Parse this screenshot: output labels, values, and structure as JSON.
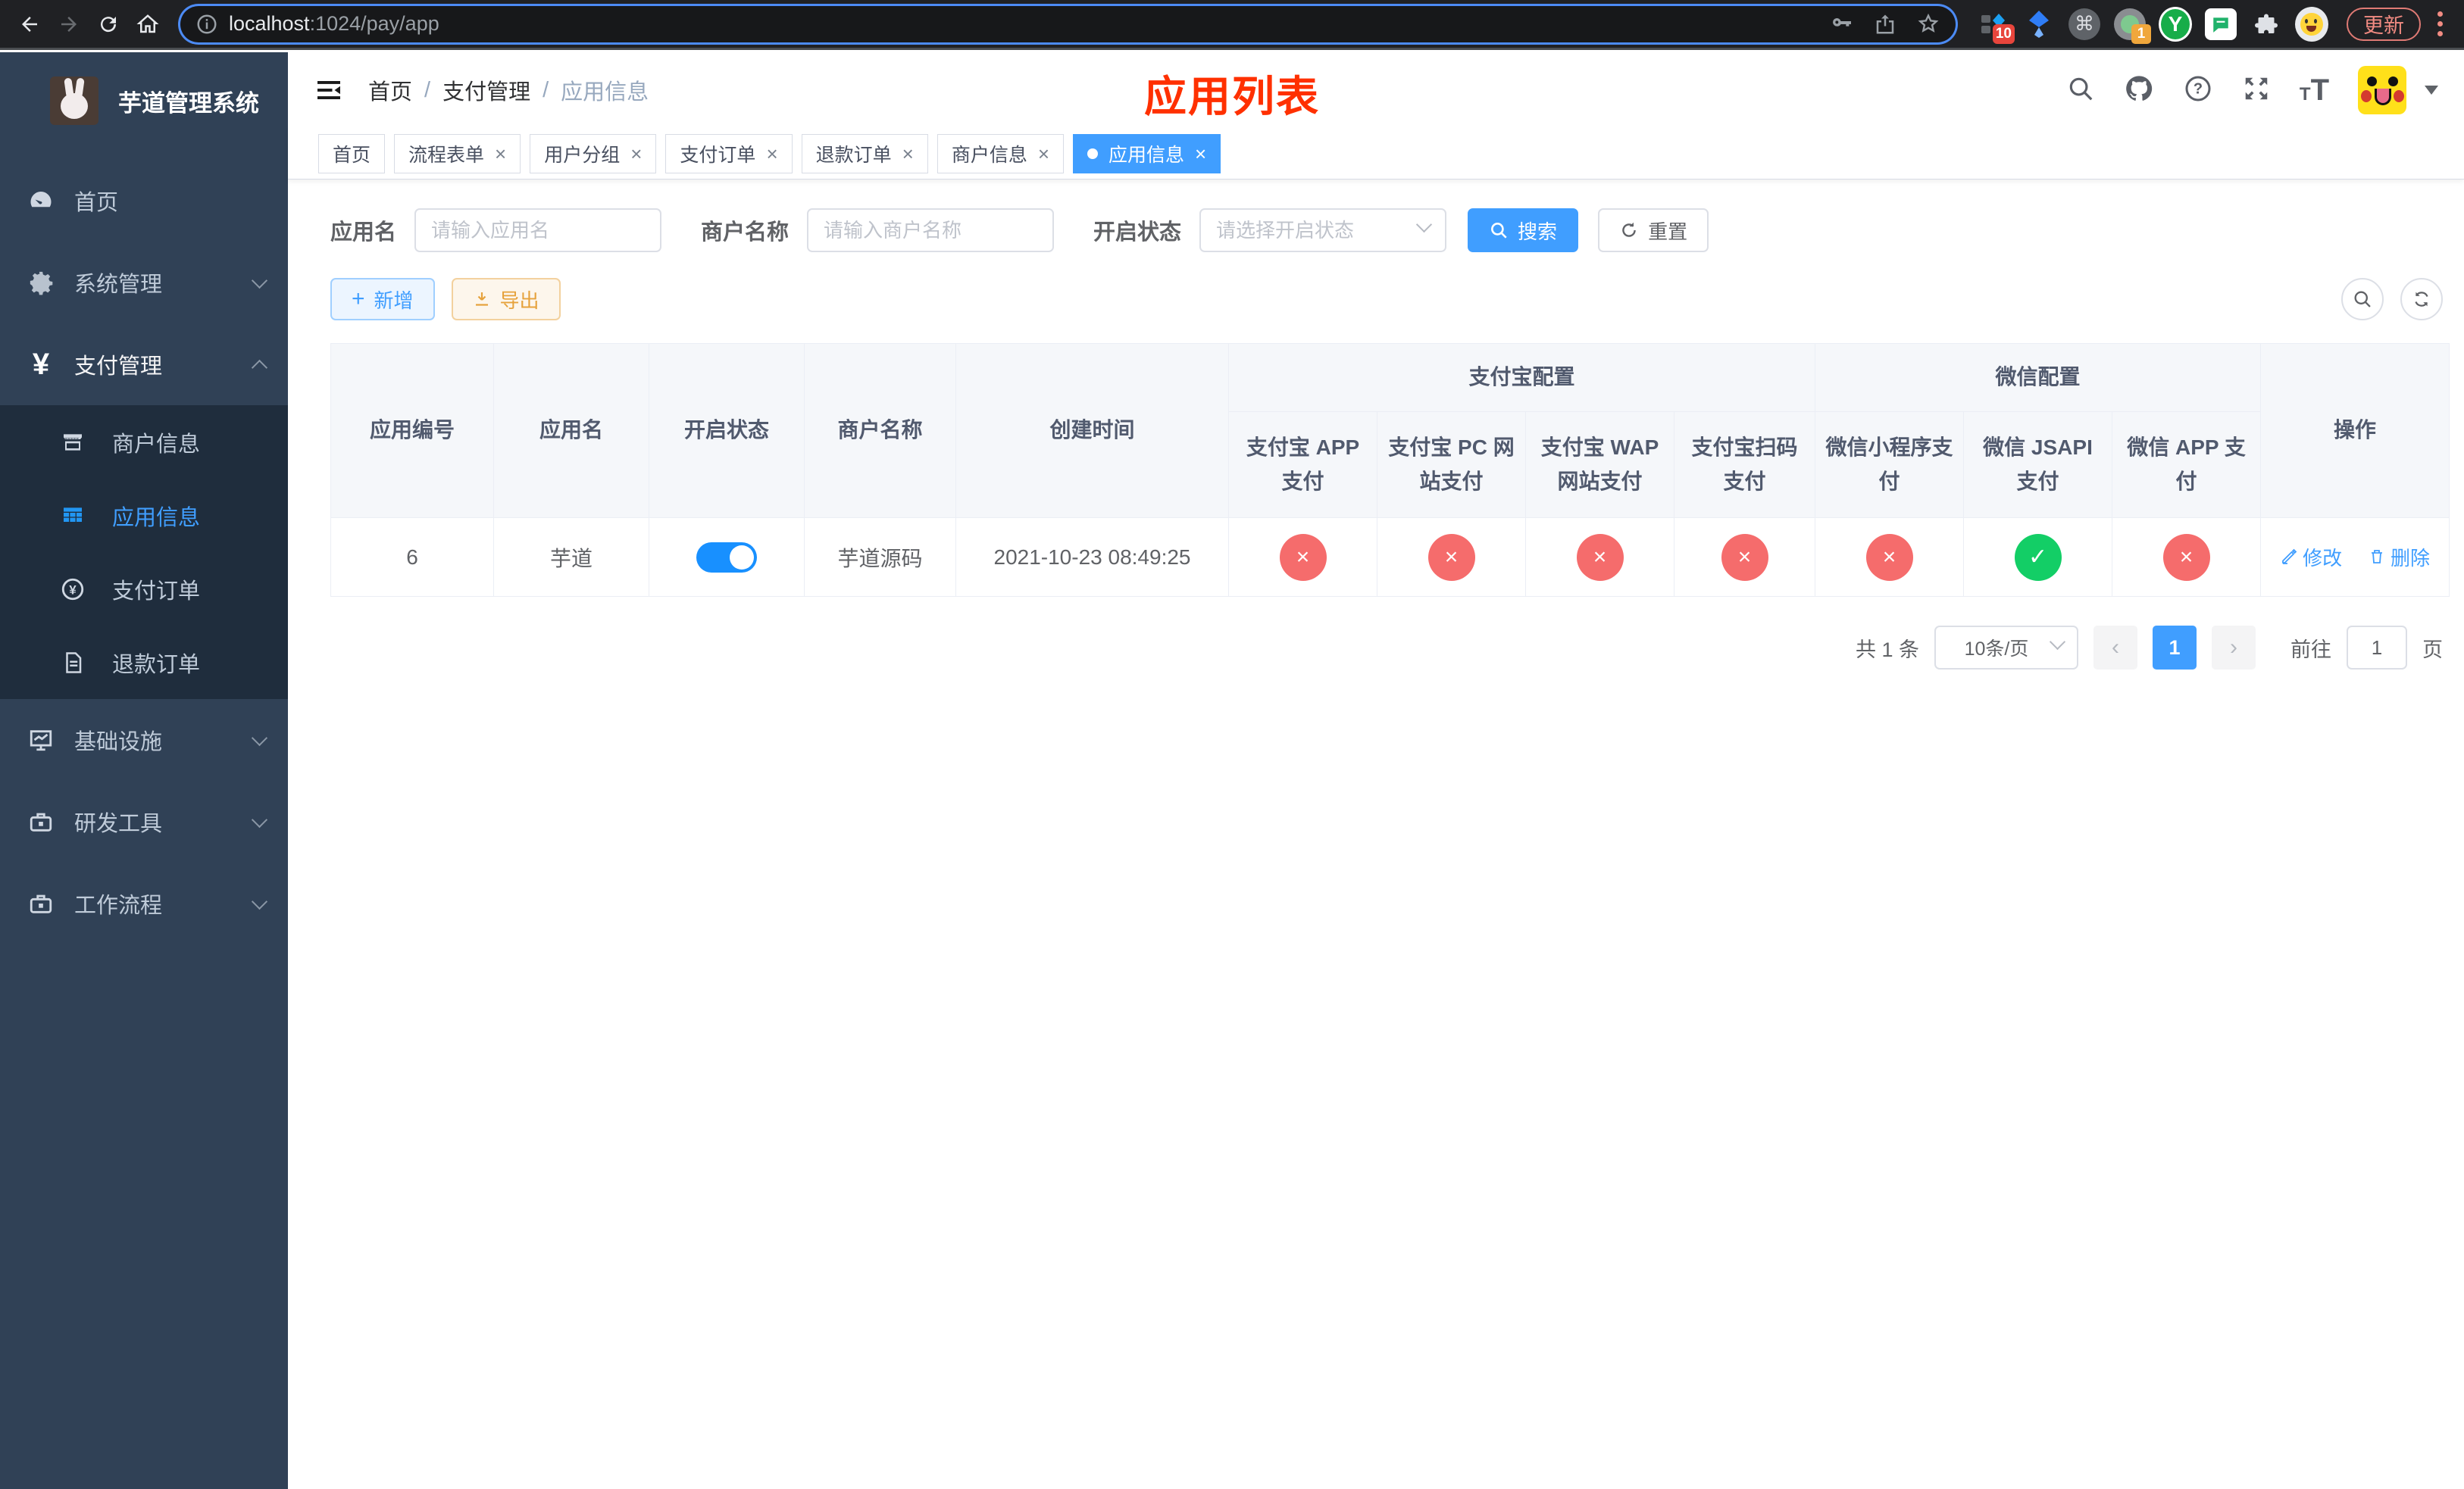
{
  "browser": {
    "url_host": "localhost",
    "url_rest": ":1024/pay/app",
    "update_label": "更新",
    "ext_badge_blocker": "10",
    "ext_badge_proxy": "1"
  },
  "sidebar": {
    "title": "芋道管理系统",
    "items": [
      {
        "label": "首页"
      },
      {
        "label": "系统管理"
      },
      {
        "label": "支付管理"
      },
      {
        "label": "基础设施"
      },
      {
        "label": "研发工具"
      },
      {
        "label": "工作流程"
      }
    ],
    "submenu": [
      {
        "label": "商户信息"
      },
      {
        "label": "应用信息"
      },
      {
        "label": "支付订单"
      },
      {
        "label": "退款订单"
      }
    ]
  },
  "navbar": {
    "breadcrumb": [
      "首页",
      "支付管理",
      "应用信息"
    ],
    "page_title": "应用列表"
  },
  "tabs": [
    {
      "label": "首页"
    },
    {
      "label": "流程表单"
    },
    {
      "label": "用户分组"
    },
    {
      "label": "支付订单"
    },
    {
      "label": "退款订单"
    },
    {
      "label": "商户信息"
    },
    {
      "label": "应用信息"
    }
  ],
  "filters": {
    "app_name_label": "应用名",
    "app_name_placeholder": "请输入应用名",
    "merchant_label": "商户名称",
    "merchant_placeholder": "请输入商户名称",
    "status_label": "开启状态",
    "status_placeholder": "请选择开启状态",
    "search_label": "搜索",
    "reset_label": "重置"
  },
  "toolbar": {
    "add_label": "新增",
    "export_label": "导出"
  },
  "table": {
    "columns": [
      "应用编号",
      "应用名",
      "开启状态",
      "商户名称",
      "创建时间"
    ],
    "groups": [
      {
        "label": "支付宝配置",
        "children": [
          "支付宝 APP 支付",
          "支付宝 PC 网站支付",
          "支付宝 WAP 网站支付",
          "支付宝扫码支付"
        ]
      },
      {
        "label": "微信配置",
        "children": [
          "微信小程序支付",
          "微信 JSAPI 支付",
          "微信 APP 支付"
        ]
      }
    ],
    "actions_column": "操作",
    "row": {
      "id": "6",
      "name": "芋道",
      "enabled": true,
      "merchant": "芋道源码",
      "created_at": "2021-10-23 08:49:25",
      "configs": [
        "disabled",
        "disabled",
        "disabled",
        "disabled",
        "disabled",
        "enabled",
        "disabled"
      ],
      "edit_label": "修改",
      "delete_label": "删除"
    }
  },
  "pagination": {
    "total_label": "共 1 条",
    "page_size": "10条/页",
    "current_page": "1",
    "goto_label": "前往",
    "goto_value": "1",
    "page_unit": "页"
  },
  "colors": {
    "primary": "#409eff",
    "danger": "#f56c6c",
    "success": "#13ce66",
    "warning": "#e6a23c",
    "title_red": "#ff3000",
    "sidebar_bg": "#304156",
    "submenu_bg": "#1f2d3d"
  }
}
